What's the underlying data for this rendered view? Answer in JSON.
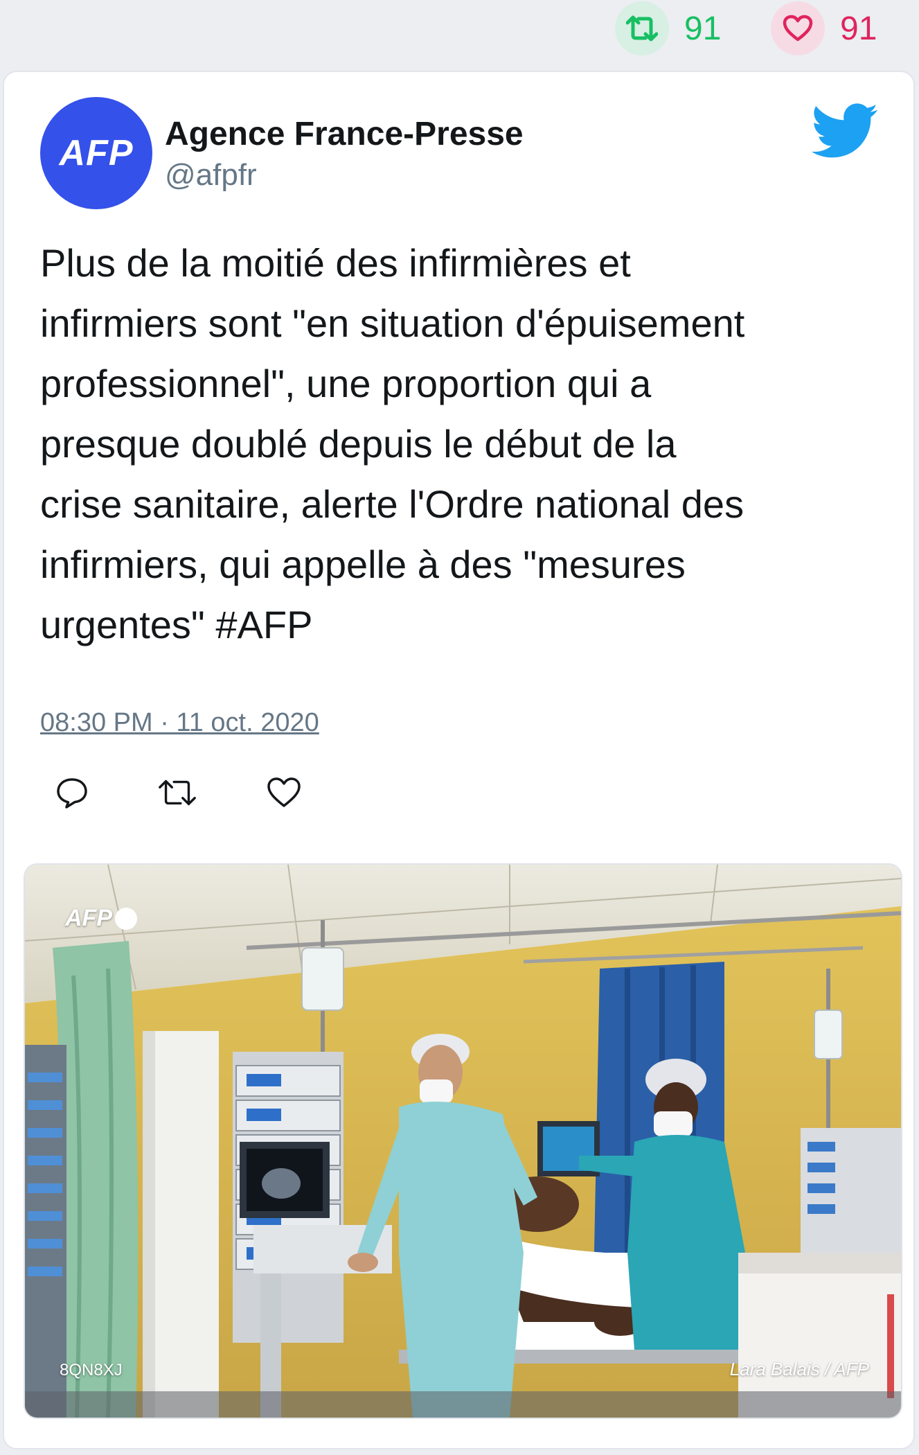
{
  "top_stats": {
    "retweet_count": "91",
    "like_count": "91",
    "retweet_icon": "retweet-icon",
    "like_icon": "heart-icon"
  },
  "tweet": {
    "author": {
      "name": "Agence France-Presse",
      "handle": "@afpfr",
      "avatar_text": "AFP"
    },
    "text": "Plus de la moitié des infirmières et\ninfirmiers sont \"en situation d'épuisement\nprofessionnel\", une proportion qui a\npresque doublé depuis le début de la\ncrise sanitaire, alerte l'Ordre national des\ninfirmiers, qui appelle à des \"mesures\nurgentes\" #AFP",
    "timestamp": "08:30 PM · 11 oct. 2020",
    "platform_icon": "twitter-bird-icon",
    "actions": [
      "reply-icon",
      "retweet-icon",
      "heart-icon"
    ],
    "media": {
      "logo_text": "AFP",
      "code": "8QN8XJ",
      "credit": "Lara Balais / AFP"
    }
  },
  "colors": {
    "background": "#eceef1",
    "card": "#ffffff",
    "retweet_green": "#17bf63",
    "like_red": "#e0245e",
    "avatar_blue": "#3451ea",
    "twitter_blue": "#1da1f2",
    "muted_text": "#657786"
  }
}
